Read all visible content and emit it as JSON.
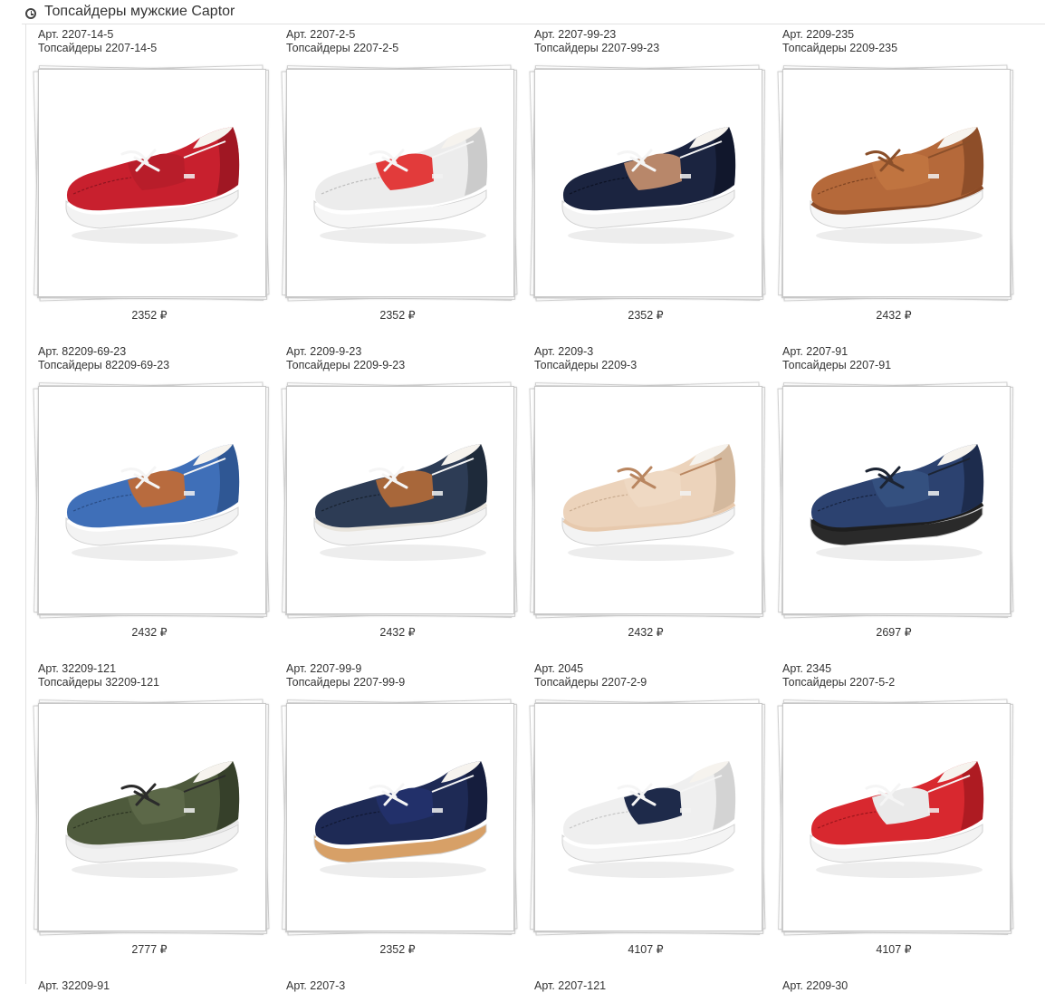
{
  "header": {
    "title": "Топсайдеры мужские Captor"
  },
  "products": [
    {
      "sku": "Арт. 2207-14-5",
      "name": "Топсайдеры 2207-14-5",
      "price": "2352 ₽",
      "colors": {
        "upper": "#c8202e",
        "upper_dark": "#8f1420",
        "tongue": "#b81d2a",
        "sole": "#f3f3f3",
        "welt": "#ffffff",
        "lace": "#f5f5f5"
      }
    },
    {
      "sku": "Арт. 2207-2-5",
      "name": "Топсайдеры 2207-2-5",
      "price": "2352 ₽",
      "colors": {
        "upper": "#ececec",
        "upper_dark": "#bdbdbd",
        "tongue": "#e23b3b",
        "sole": "#f6f6f6",
        "welt": "#ffffff",
        "lace": "#f5f5f5"
      }
    },
    {
      "sku": "Арт. 2207-99-23",
      "name": "Топсайдеры 2207-99-23",
      "price": "2352 ₽",
      "colors": {
        "upper": "#1b2440",
        "upper_dark": "#0d1224",
        "tongue": "#b8876a",
        "sole": "#f3f3f3",
        "welt": "#ffffff",
        "lace": "#f5f5f5"
      }
    },
    {
      "sku": "Арт. 2209-235",
      "name": "Топсайдеры 2209-235",
      "price": "2432 ₽",
      "colors": {
        "upper": "#b5693a",
        "upper_dark": "#7d4322",
        "tongue": "#c07440",
        "sole": "#f6f6f6",
        "welt": "#8a4a26",
        "lace": "#8a4f2a"
      }
    },
    {
      "sku": "Арт. 82209-69-23",
      "name": "Топсайдеры 82209-69-23",
      "price": "2432 ₽",
      "colors": {
        "upper": "#3f6fb8",
        "upper_dark": "#2a4d85",
        "tongue": "#b86b3e",
        "sole": "#f3f3f3",
        "welt": "#ffffff",
        "lace": "#f5f5f5"
      }
    },
    {
      "sku": "Арт. 2209-9-23",
      "name": "Топсайдеры 2209-9-23",
      "price": "2432 ₽",
      "colors": {
        "upper": "#2d3c55",
        "upper_dark": "#18222f",
        "tongue": "#a8673a",
        "sole": "#f3f3f3",
        "welt": "#e8e4dc",
        "lace": "#f5f5f5"
      }
    },
    {
      "sku": "Арт. 2209-3",
      "name": "Топсайдеры 2209-3",
      "price": "2432 ₽",
      "colors": {
        "upper": "#ecd3bb",
        "upper_dark": "#c9ac90",
        "tongue": "#efd9c3",
        "sole": "#f3f3f3",
        "welt": "#e7c9ad",
        "lace": "#b98660"
      }
    },
    {
      "sku": "Арт. 2207-91",
      "name": "Топсайдеры 2207-91",
      "price": "2697 ₽",
      "colors": {
        "upper": "#2c4270",
        "upper_dark": "#17233f",
        "tongue": "#34507f",
        "sole": "#2a2a2a",
        "welt": "#1e1e1e",
        "lace": "#1c2433"
      }
    },
    {
      "sku": "Арт. 32209-121",
      "name": "Топсайдеры 32209-121",
      "price": "2777 ₽",
      "colors": {
        "upper": "#4e5a3c",
        "upper_dark": "#2c3422",
        "tongue": "#5c6848",
        "sole": "#f1f1f1",
        "welt": "#e8e8e8",
        "lace": "#2b2b2b"
      }
    },
    {
      "sku": "Арт. 2207-99-9",
      "name": "Топсайдеры 2207-99-9",
      "price": "2352 ₽",
      "colors": {
        "upper": "#1e2a55",
        "upper_dark": "#111833",
        "tongue": "#22306a",
        "sole": "#d7a067",
        "welt": "#ffffff",
        "lace": "#f5f5f5"
      }
    },
    {
      "sku": "Арт. 2045",
      "name": "Топсайдеры 2207-2-9",
      "price": "4107 ₽",
      "colors": {
        "upper": "#efefef",
        "upper_dark": "#c7c7c7",
        "tongue": "#1e2a4a",
        "sole": "#f4f4f4",
        "welt": "#ffffff",
        "lace": "#f5f5f5"
      }
    },
    {
      "sku": "Арт. 2345",
      "name": "Топсайдеры 2207-5-2",
      "price": "4107 ₽",
      "colors": {
        "upper": "#d8282f",
        "upper_dark": "#9c161c",
        "tongue": "#eaeaea",
        "sole": "#f3f3f3",
        "welt": "#ffffff",
        "lace": "#f5f5f5"
      }
    }
  ],
  "partial_row": [
    {
      "sku": "Арт. 32209-91"
    },
    {
      "sku": "Арт. 2207-3"
    },
    {
      "sku": "Арт. 2207-121"
    },
    {
      "sku": "Арт. 2209-30"
    }
  ],
  "icons": {
    "header": "clock-icon"
  }
}
